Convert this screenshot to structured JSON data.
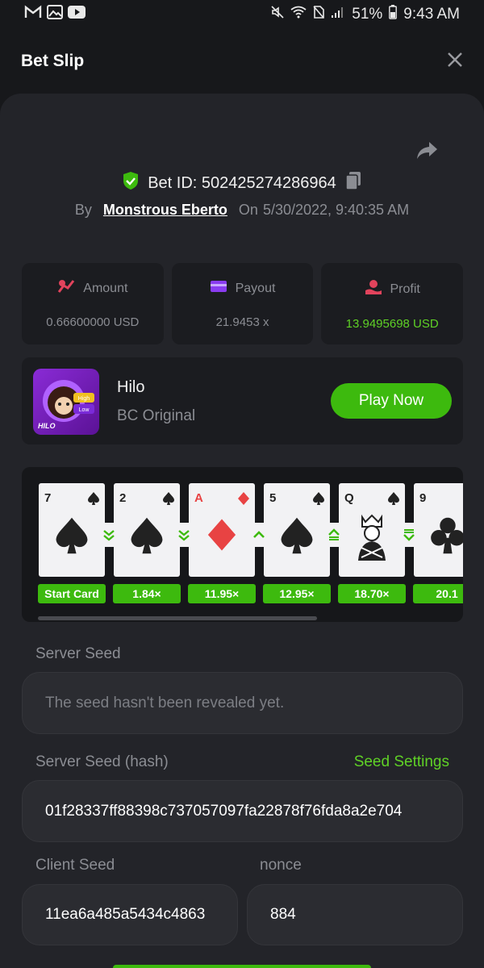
{
  "status": {
    "battery": "51%",
    "time": "9:43 AM"
  },
  "header": {
    "title": "Bet Slip"
  },
  "bet": {
    "id_label": "Bet ID: 502425274286964",
    "by_label": "By",
    "user": "Monstrous Eberto",
    "on_label": "On",
    "date": "5/30/2022, 9:40:35 AM"
  },
  "stats": [
    {
      "label": "Amount",
      "value": "0.66600000 USD",
      "icon": "amount-icon"
    },
    {
      "label": "Payout",
      "value": "21.9453 x",
      "icon": "card-icon"
    },
    {
      "label": "Profit",
      "value": "13.9495698 USD",
      "icon": "profit-icon",
      "color": "#5fd126"
    }
  ],
  "game": {
    "name": "Hilo",
    "subtitle": "BC Original",
    "play_label": "Play Now",
    "thumb_text": "HILO",
    "thumb_high": "High",
    "thumb_low": "Low"
  },
  "cards": [
    {
      "rank": "7",
      "suit": "spade",
      "multiplier": "Start Card"
    },
    {
      "rank": "2",
      "suit": "spade",
      "multiplier": "1.84×",
      "guess": "low"
    },
    {
      "rank": "A",
      "suit": "diamond",
      "multiplier": "11.95×",
      "guess": "low"
    },
    {
      "rank": "5",
      "suit": "spade",
      "multiplier": "12.95×",
      "guess": "high"
    },
    {
      "rank": "Q",
      "suit": "spade",
      "multiplier": "18.70×",
      "guess": "high-equal"
    },
    {
      "rank": "9",
      "suit": "club",
      "multiplier": "20.1",
      "guess": "low-equal"
    }
  ],
  "seeds": {
    "server_label": "Server Seed",
    "server_placeholder": "The seed hasn't been revealed yet.",
    "hash_label": "Server Seed (hash)",
    "seed_settings": "Seed Settings",
    "hash_value": "01f28337ff88398c737057097fa22878f76fda8a2e704",
    "client_label": "Client Seed",
    "client_value": "11ea6a485a5434c4863",
    "nonce_label": "nonce",
    "nonce_value": "884"
  }
}
